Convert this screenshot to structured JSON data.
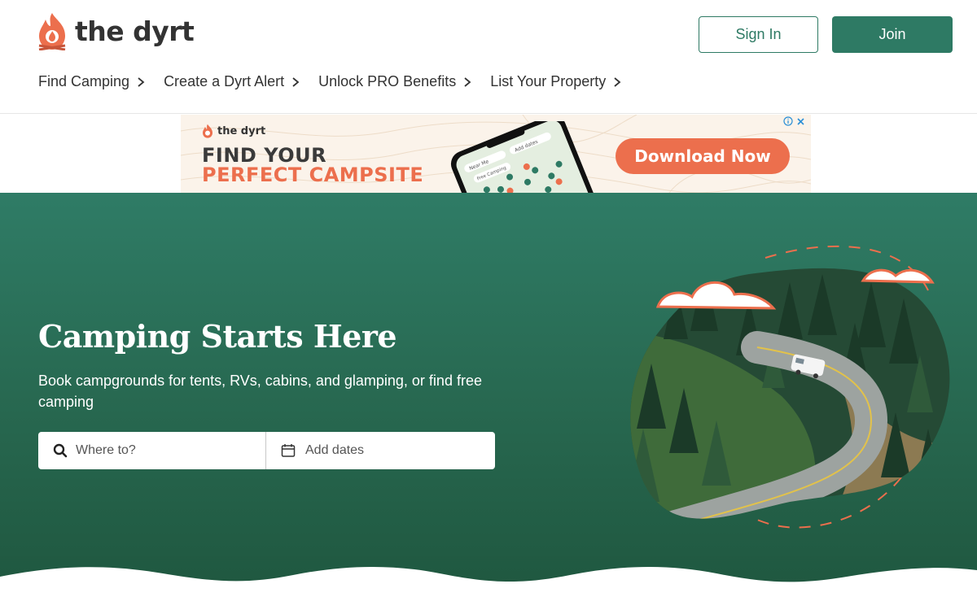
{
  "brand": {
    "name": "the dyrt",
    "accent": "#2e7a64",
    "orange": "#ec6f4d"
  },
  "header": {
    "sign_in": "Sign In",
    "join": "Join"
  },
  "nav": [
    {
      "label": "Find Camping"
    },
    {
      "label": "Create a Dyrt Alert"
    },
    {
      "label": "Unlock PRO Benefits"
    },
    {
      "label": "List Your Property"
    }
  ],
  "ad": {
    "logo": "the dyrt",
    "headline_1": "FIND YOUR",
    "headline_2": "PERFECT CAMPSITE",
    "cta": "Download Now",
    "phone_search_1": "Near Me",
    "phone_search_2": "Add dates",
    "phone_chip": "Free Camping"
  },
  "hero": {
    "title": "Camping Starts Here",
    "subtitle": "Book campgrounds for tents, RVs, cabins, and glamping, or find free camping",
    "search": {
      "where_placeholder": "Where to?",
      "dates_label": "Add dates"
    }
  }
}
